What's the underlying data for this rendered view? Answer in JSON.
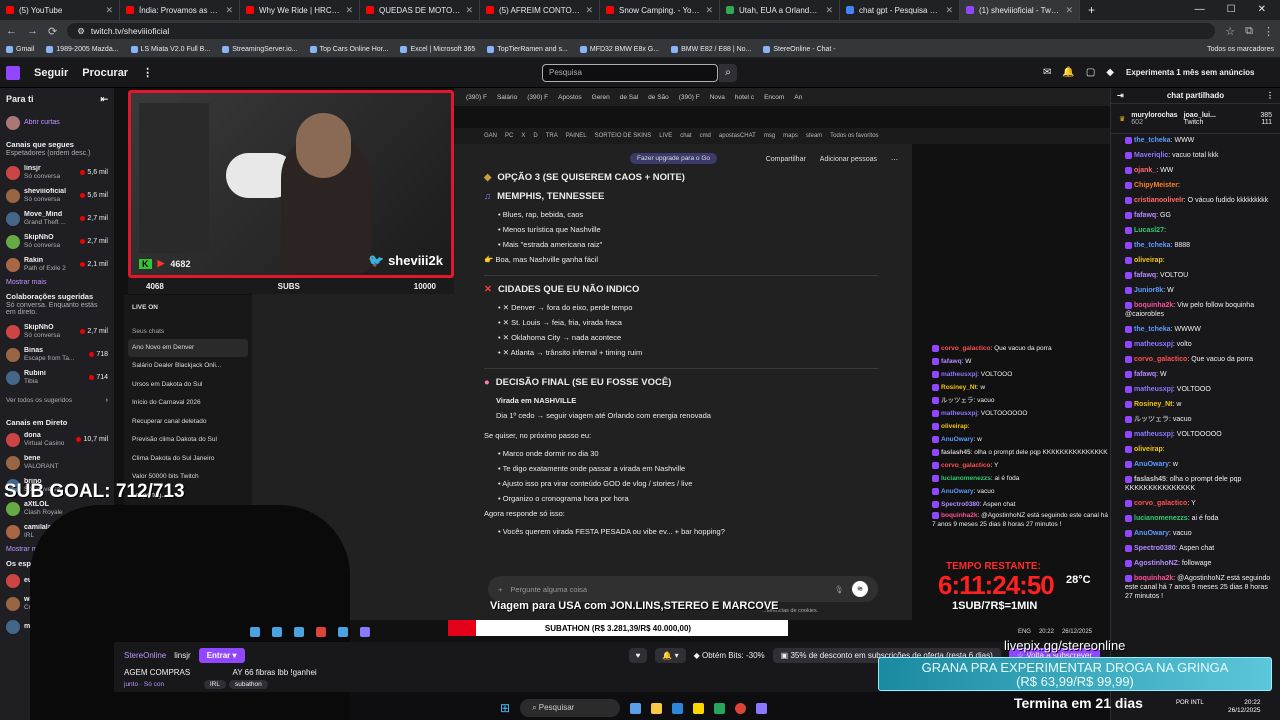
{
  "browser": {
    "tabs": [
      {
        "label": "(5) YouTube",
        "color": "#ff0000"
      },
      {
        "label": "Índia: Provamos as Comidas de",
        "color": "#ff0000"
      },
      {
        "label": "Why We Ride | HRC Rally Raid",
        "color": "#ff0000"
      },
      {
        "label": "QUEDAS DE MOTO (EP. 163) -",
        "color": "#ff0000"
      },
      {
        "label": "(5) AFREIM CONTOU PORQUE",
        "color": "#ff0000"
      },
      {
        "label": "Snow Camping. - YouTube",
        "color": "#ff0000"
      },
      {
        "label": "Utah, EUA a Orlando, Florida,",
        "color": "#34a853"
      },
      {
        "label": "chat gpt - Pesquisa Google",
        "color": "#4285f4"
      },
      {
        "label": "(1) sheviiioficial - Twitch",
        "color": "#9147ff"
      }
    ],
    "url": "twitch.tv/sheviiioficial",
    "bookmarks": [
      "Gmail",
      "1989-2005 Mazda...",
      "LS Miata V2.0 Full B...",
      "StreamingServer.io...",
      "Top Cars Online Hor...",
      "Excel | Microsoft 365",
      "TopTierRamen and s...",
      "MFD32 BMW E8x G...",
      "BMW E82 / E88 | No...",
      "StereOnline - Chat -"
    ],
    "bookmarks_all": "Todos os marcadores"
  },
  "twitch": {
    "nav": {
      "follow": "Seguir",
      "browse": "Procurar",
      "search_placeholder": "Pesquisa",
      "promo": "Experimenta 1 mês sem anúncios"
    },
    "sidebar": {
      "title": "Para ti",
      "open_shorts": "Abrir curtas",
      "followed_title": "Canais que segues",
      "followed_sub": "Espetadores (ordem desc.)",
      "followed": [
        {
          "name": "linsjr",
          "game": "Só conversa",
          "viewers": "5,6 mil"
        },
        {
          "name": "sheviiioficial",
          "game": "Só conversa",
          "viewers": "5,6 mil"
        },
        {
          "name": "Move_Mind",
          "game": "Grand Theft ...",
          "viewers": "2,7 mil"
        },
        {
          "name": "SkipNhO",
          "game": "Só conversa",
          "viewers": "2,7 mil"
        },
        {
          "name": "Rakin",
          "game": "Path of Exile 2",
          "viewers": "2,1 mil"
        }
      ],
      "show_more": "Mostrar mais",
      "collab_title": "Colaborações sugeridas",
      "collab_sub": "Só conversa. Enquanto estás em direto.",
      "collab": [
        {
          "name": "SkipNhO",
          "game": "Só conversa",
          "viewers": "2,7 mil"
        },
        {
          "name": "Binas",
          "game": "Escape from Ta...",
          "viewers": "718"
        },
        {
          "name": "Rubini",
          "game": "Tibia",
          "viewers": "714"
        }
      ],
      "see_all": "Ver todos os sugeridos",
      "live_title": "Canais em Direto",
      "live": [
        {
          "name": "dona",
          "game": "Virtual Casino",
          "viewers": "10,7 mil"
        },
        {
          "name": "bene",
          "game": "VALORANT",
          "viewers": ""
        },
        {
          "name": "brino",
          "game": "Só conversa",
          "viewers": ""
        },
        {
          "name": "aXtLOL",
          "game": "Clash Royale",
          "viewers": ""
        },
        {
          "name": "camilalar",
          "game": "IRL",
          "viewers": ""
        }
      ],
      "show_more2": "Mostrar m",
      "watch_title": "Os espeta sheviiioficia",
      "watch": [
        {
          "name": "euEllen",
          "game": ""
        },
        {
          "name": "wavelgl",
          "game": "Counter-S"
        },
        {
          "name": "mesquita",
          "game": ""
        }
      ]
    },
    "chat": {
      "header": "chat partilhado",
      "pinned_user": "murylorochas",
      "pinned_amount": "602",
      "pinned_user2": "joao_lui...",
      "pinned_amount2": "385",
      "pinned_sub": "Twitch",
      "pinned_amount3": "111",
      "messages": [
        {
          "user": "the_tcheka",
          "text": "WWW",
          "color": "#5c9cff"
        },
        {
          "user": "Maveriqlic",
          "text": "vacuo total kkk",
          "color": "#8a78ff"
        },
        {
          "user": "ojank_",
          "text": "WW",
          "color": "#ff6b6b"
        },
        {
          "user": "ChipyMeister",
          "text": "",
          "color": "#ff7f27"
        },
        {
          "user": "cristianoolivelr",
          "text": "O vácuo fudido kkkkkkkkk",
          "color": "#ff6b6b"
        },
        {
          "user": "fafawq",
          "text": "GG",
          "color": "#b48aff"
        },
        {
          "user": "Lucasl27",
          "text": "",
          "color": "#2ecc71"
        },
        {
          "user": "the_tcheka",
          "text": "8888",
          "color": "#5c9cff"
        },
        {
          "user": "oliveirap",
          "text": "",
          "color": "#f1c40f"
        },
        {
          "user": "fafawq",
          "text": "VOLTOU",
          "color": "#b48aff"
        },
        {
          "user": "Junior8k",
          "text": "W",
          "color": "#5c9cff"
        },
        {
          "user": "boquinha2k",
          "text": "Viw pelo follow boquinha @caiorobles",
          "color": "#ff4f9a"
        },
        {
          "user": "the_tcheka",
          "text": "WWWW",
          "color": "#5c9cff"
        },
        {
          "user": "matheusxpj",
          "text": "volto",
          "color": "#8a78ff"
        },
        {
          "user": "corvo_galactico",
          "text": "Que vacuo da porra",
          "color": "#ff4f4f"
        },
        {
          "user": "fafawq",
          "text": "W",
          "color": "#b48aff"
        },
        {
          "user": "matheusxpj",
          "text": "VOLTOOO",
          "color": "#8a78ff"
        },
        {
          "user": "Rosiney_Nt",
          "text": "w",
          "color": "#f1c40f"
        },
        {
          "user": "ルッツェラ",
          "text": "vacuo",
          "color": "#aaaaaa"
        },
        {
          "user": "matheusxpj",
          "text": "VOLTOOOOO",
          "color": "#8a78ff"
        },
        {
          "user": "oliveirap",
          "text": "",
          "color": "#f1c40f"
        },
        {
          "user": "AnuOwary",
          "text": "w",
          "color": "#5c9cff"
        },
        {
          "user": "faslash45",
          "text": "olha o prompt dele pqp KKKKKKKKKKKKKKK",
          "color": "#cccccc"
        },
        {
          "user": "corvo_galactico",
          "text": "Y",
          "color": "#ff4f4f"
        },
        {
          "user": "lucianomenezzs",
          "text": "ai é foda",
          "color": "#2ecc71"
        },
        {
          "user": "AnuOwary",
          "text": "vacuo",
          "color": "#5c9cff"
        },
        {
          "user": "Spectro0380",
          "text": "Aspen chat",
          "color": "#b48aff"
        },
        {
          "user": "AgostinhoNZ",
          "text": "followage",
          "color": "#b48aff"
        },
        {
          "user": "boquinha2k",
          "text": "@AgostinhoNZ está seguindo este canal há 7 anos 9 meses 25 dias 8 horas 27 minutos !",
          "color": "#ff4f9a"
        }
      ]
    },
    "info": {
      "streamer": "StereOnline",
      "collab_user": "linsjr",
      "enter": "Entrar",
      "title": "AGEM COMPRAS",
      "title2": "AY 66 fibras lbb !ganhei",
      "tag1": "IRL",
      "tag2": "subathon",
      "tag0": "junto · Só con",
      "bits": "Obtém Bits: -30%",
      "discount": "35% de desconto em subscrições de oferta (resta 6 dias)",
      "resub": "Volta a subscrever"
    }
  },
  "stream": {
    "cam_name": "sheviii2k",
    "cam_stat": "4682",
    "subs_left": "4068",
    "subs_label": "SUBS",
    "subs_right": "10000",
    "live_on": "LIVE ON",
    "sub_goal": "SUB GOAL: 712/713",
    "trip_caption": "Viagem para USA com JON.LINS,STEREO E MARCOVE",
    "subathon": "SUBATHON (R$ 3.281,39/R$ 40.000,00)",
    "subathon_progress": 0.082,
    "timer_label": "TEMPO RESTANTE:",
    "timer": "6:11:24:50",
    "temp": "28°C",
    "sub_price": "1SUB/7R$=1MIN",
    "livepix": "livepix.gg/stereonline",
    "grana_line1": "GRANA PRA EXPERIMENTAR DROGA NA GRINGA",
    "grana_line2": "(R$ 63,99/R$ 99,99)",
    "termina": "Termina em 21 dias",
    "inner_tabs": [
      "(390) F",
      "Salário",
      "(390) F",
      "Apostos",
      "Geren",
      "de Sal",
      "de São",
      "(390) F",
      "Nova",
      "hotel c",
      "Encom",
      "An"
    ],
    "inner_bm": [
      "GAN",
      "PC",
      "X",
      "D",
      "TRA",
      "PAINEL",
      "SORTEIO DE SKINS",
      "LIVE",
      "chat",
      "cmd",
      "apostasCHAT",
      "msg",
      "maps",
      "steam",
      "Todos os favoritos"
    ],
    "side_header": "Seus chats",
    "side_chats": [
      "Ano Novo em Denver",
      "Salário Dealer Blackjack Onli...",
      "Ursos em Dakota do Sul",
      "Início do Carnaval 2026",
      "Recuperar canal deletado",
      "Previsão clima Dakota do Sul",
      "Clima Dakota do Sul Janeiro",
      "Valor 50000 bits Twitch",
      "em portug..."
    ],
    "gpt": {
      "upgrade": "Fazer upgrade para o Go",
      "share": "Compartilhar",
      "add": "Adicionar pessoas",
      "h1": "OPÇÃO 3 (SE QUISEREM CAOS + NOITE)",
      "h2": "MEMPHIS, TENNESSEE",
      "list1": [
        "Blues, rap, bebida, caos",
        "Menos turística que Nashville",
        "Mais \"estrada americana raiz\""
      ],
      "p1": "Boa, mas Nashville ganha fácil",
      "h3": "CIDADES QUE EU NÃO INDICO",
      "list2": [
        "Denver → fora do eixo, perde tempo",
        "St. Louis → feia, fria, virada fraca",
        "Oklahoma City → nada acontece",
        "Atlanta → trânsito infernal + timing ruim"
      ],
      "h4": "DECISÃO FINAL (SE EU FOSSE VOCÊ)",
      "final1": "Virada em NASHVILLE",
      "final2": "Dia 1º cedo → seguir viagem até Orlando com energia renovada",
      "p2": "Se quiser, no próximo passo eu:",
      "list3": [
        "Marco onde dormir no dia 30",
        "Te digo exatamente onde passar a virada em Nashville",
        "Ajusto isso pra virar conteúdo GOD de vlog / stories / live",
        "Organizo o cronograma hora por hora"
      ],
      "p3": "Agora responde só isso:",
      "list4": [
        "Vocês querem virada FESTA PESADA ou vibe ev... + bar hopping?"
      ],
      "input_placeholder": "Pergunte alguma coisa",
      "cookie": "...ferências de cookies."
    },
    "overlay_chat": [
      {
        "user": "corvo_galactico",
        "text": "Que vacuo da porra"
      },
      {
        "user": "fafawq",
        "text": "W"
      },
      {
        "user": "matheusxpj",
        "text": "VOLTOOO"
      },
      {
        "user": "Rosiney_Nt",
        "text": "w"
      },
      {
        "user": "ルッツェラ",
        "text": "vacuo"
      },
      {
        "user": "matheusxpj",
        "text": "VOLTOOOOOO"
      },
      {
        "user": "oliveirap",
        "text": ""
      },
      {
        "user": "AnuOwary",
        "text": "w"
      },
      {
        "user": "faslash45",
        "text": "olha o prompt dele pqp KKKKKKKKKKKKKKK"
      },
      {
        "user": "corvo_galactico",
        "text": "Y"
      },
      {
        "user": "lucianomenezzs",
        "text": "ai é foda"
      },
      {
        "user": "AnuOwary",
        "text": "vacuo"
      },
      {
        "user": "Spectro0380",
        "text": "Aspen chat"
      },
      {
        "user": "boquinha2k",
        "text": "@AgostinhoNZ está seguindo este canal há 7 anos 9 meses 25 dias 8 horas 27 minutos !"
      }
    ],
    "inner_clock": {
      "lang": "ENG",
      "time": "20:22",
      "date": "26/12/2025"
    }
  },
  "taskbar": {
    "search": "Pesquisar",
    "lang": "POR INTL",
    "time": "20:22",
    "date": "26/12/2025"
  },
  "colors": {
    "twitch": "#9147ff",
    "live": "#eb0400",
    "timer": "#ff2020"
  }
}
